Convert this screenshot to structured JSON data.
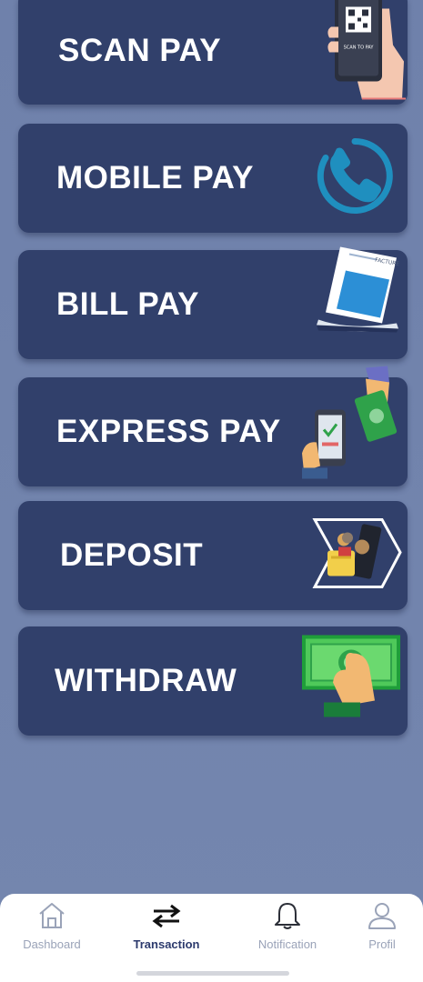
{
  "menu": {
    "items": [
      {
        "label": "SCAN PAY",
        "icon": "qr-phone-icon",
        "icon_text": "SCAN TO PAY"
      },
      {
        "label": "MOBILE PAY",
        "icon": "phone-call-icon"
      },
      {
        "label": "BILL PAY",
        "icon": "invoice-icon",
        "icon_text": "FACTURE"
      },
      {
        "label": "EXPRESS PAY",
        "icon": "phone-cash-icon"
      },
      {
        "label": "DEPOSIT",
        "icon": "wallet-deposit-icon"
      },
      {
        "label": "WITHDRAW",
        "icon": "cash-withdraw-icon"
      }
    ]
  },
  "bottom_nav": {
    "items": [
      {
        "label": "Dashboard",
        "icon": "home-icon",
        "active": false
      },
      {
        "label": "Transaction",
        "icon": "transfer-arrows-icon",
        "active": true
      },
      {
        "label": "Notification",
        "icon": "bell-icon",
        "active": false
      },
      {
        "label": "Profil",
        "icon": "user-icon",
        "active": false
      }
    ]
  },
  "colors": {
    "background": "#6e7fa9",
    "card": "#31406b",
    "card_text": "#ffffff",
    "nav_active": "#2c3a6d",
    "nav_inactive": "#9aa3b8"
  }
}
